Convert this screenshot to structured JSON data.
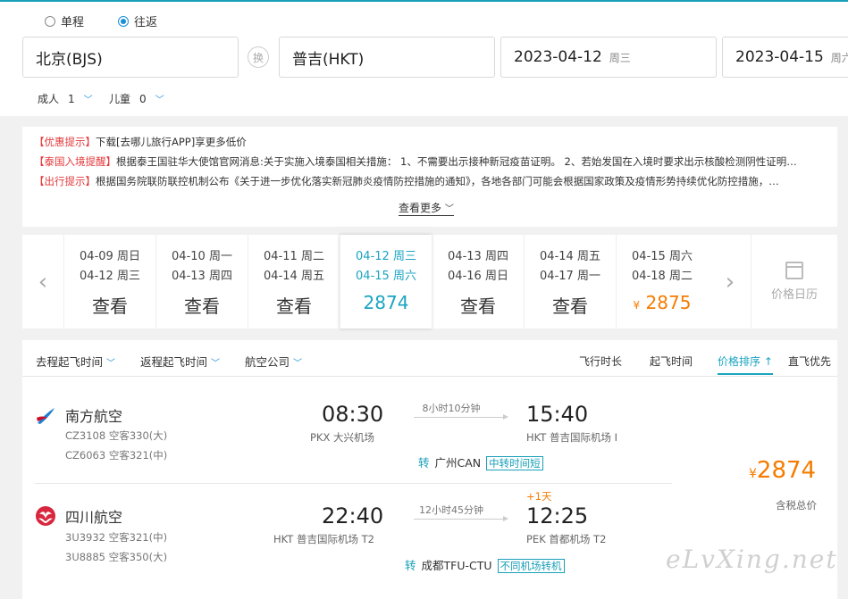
{
  "trip_type": {
    "one_way": "单程",
    "round_trip": "往返"
  },
  "search": {
    "from": "北京(BJS)",
    "swap": "换",
    "to": "普吉(HKT)",
    "depart_date": "2023-04-12",
    "depart_weekday": "周三",
    "return_date": "2023-04-15",
    "return_weekday": "周六",
    "adults_label": "成人",
    "adults": "1",
    "children_label": "儿童",
    "children": "0"
  },
  "notices": [
    {
      "tag": "【优惠提示】",
      "text": "下载[去哪儿旅行APP]享更多低价"
    },
    {
      "tag": "【泰国入境提醒】",
      "text": "根据泰王国驻华大使馆官网消息:关于实施入境泰国相关措施： 1、不需要出示接种新冠疫苗证明。 2、若始发国在入境时要求出示核酸检测阴性证明…"
    },
    {
      "tag": "【出行提示】",
      "text": "根据国务院联防联控机制公布《关于进一步优化落实新冠肺炎疫情防控措施的通知》，各地各部门可能会根据国家政策及疫情形势持续优化防控措施，…"
    }
  ],
  "see_more": "查看更多",
  "dates": [
    {
      "out": "04-09 周日",
      "ret": "04-12 周三",
      "price": "查看"
    },
    {
      "out": "04-10 周一",
      "ret": "04-13 周四",
      "price": "查看"
    },
    {
      "out": "04-11 周二",
      "ret": "04-14 周五",
      "price": "查看"
    },
    {
      "out": "04-12 周三",
      "ret": "04-15 周六",
      "price": "2874"
    },
    {
      "out": "04-13 周四",
      "ret": "04-16 周日",
      "price": "查看"
    },
    {
      "out": "04-14 周五",
      "ret": "04-17 周一",
      "price": "查看"
    },
    {
      "out": "04-15 周六",
      "ret": "04-18 周二",
      "price": "2875",
      "yen": "¥"
    }
  ],
  "calendar_label": "价格日历",
  "filters": {
    "depart_time": "去程起飞时间",
    "return_time": "返程起飞时间",
    "airline": "航空公司"
  },
  "sorts": {
    "duration": "飞行时长",
    "takeoff": "起飞时间",
    "price": "价格排序",
    "price_arrow": "↑",
    "direct": "直飞优先"
  },
  "flight": {
    "outbound": {
      "airline": "南方航空",
      "flight1": "CZ3108 空客330(大)",
      "flight2": "CZ6063 空客321(中)",
      "dep_time": "08:30",
      "dep_airport": "PKX 大兴机场",
      "duration": "8小时10分钟",
      "arr_time": "15:40",
      "arr_airport": "HKT 普吉国际机场 I",
      "transfer_mark": "转",
      "transfer_city": "广州CAN",
      "transfer_tag": "中转时间短"
    },
    "inbound": {
      "airline": "四川航空",
      "flight1": "3U3932 空客321(中)",
      "flight2": "3U8885 空客350(大)",
      "dep_time": "22:40",
      "dep_airport": "HKT 普吉国际机场 T2",
      "duration": "12小时45分钟",
      "next_day": "+1天",
      "arr_time": "12:25",
      "arr_airport": "PEK 首都机场 T2",
      "transfer_mark": "转",
      "transfer_city": "成都TFU-CTU",
      "transfer_tag": "不同机场转机"
    },
    "price_currency": "¥",
    "price": "2874",
    "price_note": "含税总价"
  },
  "watermark": "eLvXing.net"
}
